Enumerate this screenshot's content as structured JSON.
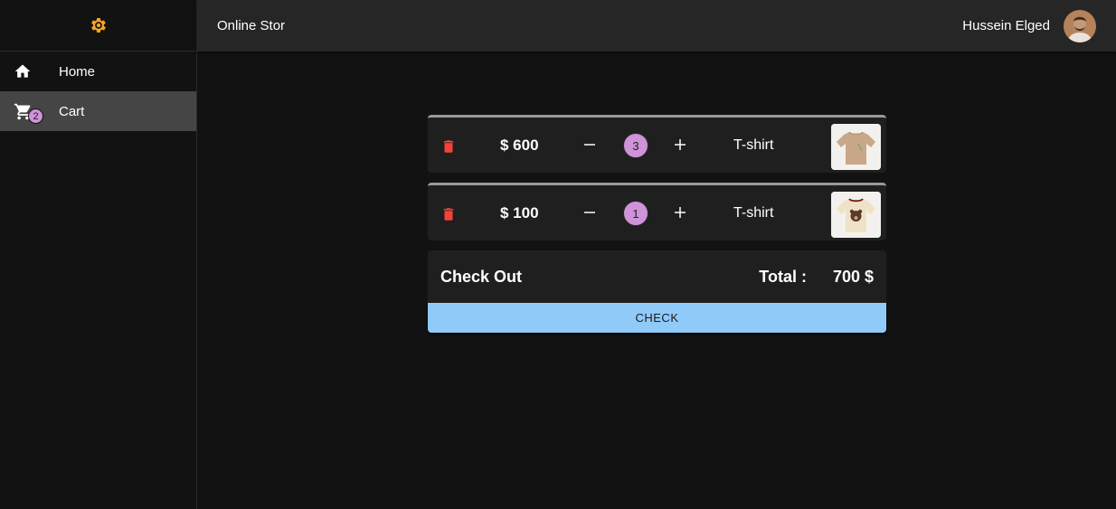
{
  "app": {
    "title": "Online Stor"
  },
  "user": {
    "name": "Hussein Elged"
  },
  "sidebar": {
    "logo_icon": "gear-icon",
    "items": [
      {
        "label": "Home",
        "icon": "home-icon",
        "active": false
      },
      {
        "label": "Cart",
        "icon": "cart-icon",
        "active": true,
        "badge": "2"
      }
    ]
  },
  "cart": {
    "items": [
      {
        "price": "$ 600",
        "quantity": "3",
        "name": "T-shirt",
        "image": "tshirt-beige"
      },
      {
        "price": "$ 100",
        "quantity": "1",
        "name": "T-shirt",
        "image": "tshirt-bear-print"
      }
    ]
  },
  "checkout": {
    "title": "Check Out",
    "total_label": "Total :",
    "total_value": "700 $",
    "button_label": "CHECK"
  },
  "colors": {
    "accent_gear": "#f5a623",
    "delete": "#f44336",
    "badge": "#ce93d8",
    "button": "#90caf9"
  }
}
